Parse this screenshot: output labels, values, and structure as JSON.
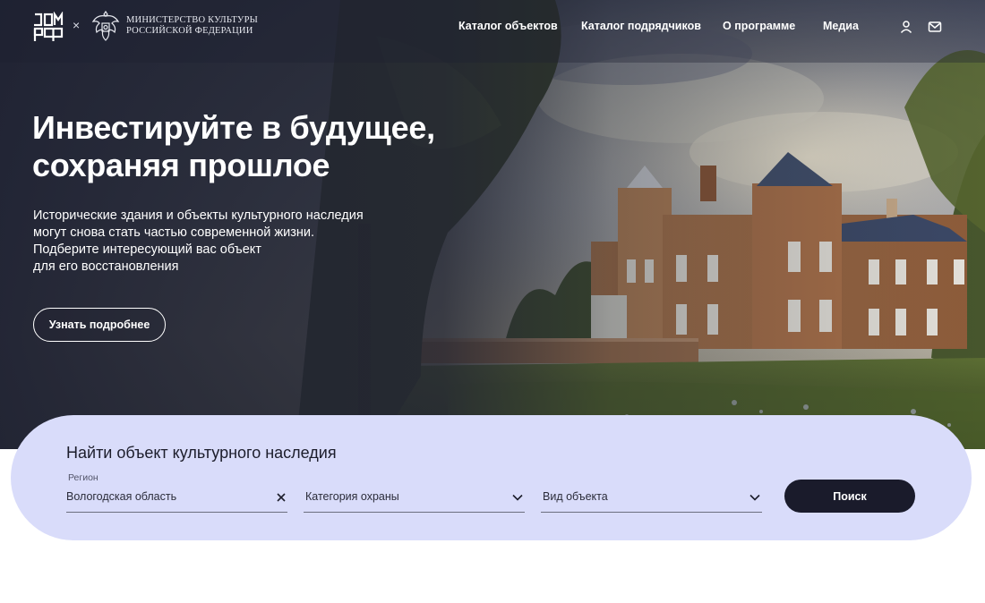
{
  "header": {
    "logo_text": "ДОМ РФ",
    "separator": "×",
    "ministry_line1": "МИНИСТЕРСТВО КУЛЬТУРЫ",
    "ministry_line2": "РОССИЙСКОЙ ФЕДЕРАЦИИ",
    "nav": [
      {
        "label": "Каталог объектов"
      },
      {
        "label": "Каталог подрядчиков"
      },
      {
        "label": "О программе"
      },
      {
        "label": "Медиа"
      }
    ],
    "icons": [
      "user-icon",
      "mail-icon"
    ]
  },
  "hero": {
    "title_line1": "Инвестируйте в будущее,",
    "title_line2": "сохраняя прошлое",
    "desc_lines": [
      "Исторические здания и объекты культурного наследия",
      "могут снова стать частью современной жизни.",
      "Подберите интересующий вас объект",
      "для его восстановления"
    ],
    "more_button": "Узнать подробнее"
  },
  "search": {
    "title": "Найти объект культурного наследия",
    "region_label": "Регион",
    "region_value": "Вологодская область",
    "category_placeholder": "Категория охраны",
    "type_placeholder": "Вид объекта",
    "button": "Поиск"
  },
  "colors": {
    "search_panel": "#d9dcfa",
    "button_dark": "#1a1b2b",
    "text_white": "#ffffff"
  }
}
